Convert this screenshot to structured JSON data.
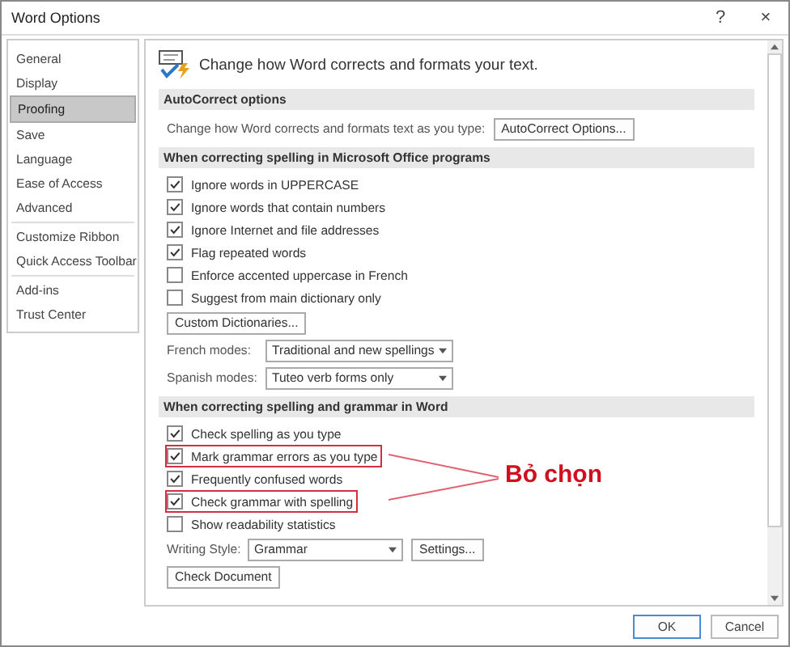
{
  "window": {
    "title": "Word Options",
    "help": "?",
    "close": "×"
  },
  "sidebar": {
    "groups": [
      [
        {
          "label": "General",
          "selected": false
        },
        {
          "label": "Display",
          "selected": false
        },
        {
          "label": "Proofing",
          "selected": true
        },
        {
          "label": "Save",
          "selected": false
        },
        {
          "label": "Language",
          "selected": false
        },
        {
          "label": "Ease of Access",
          "selected": false
        },
        {
          "label": "Advanced",
          "selected": false
        }
      ],
      [
        {
          "label": "Customize Ribbon",
          "selected": false
        },
        {
          "label": "Quick Access Toolbar",
          "selected": false
        }
      ],
      [
        {
          "label": "Add-ins",
          "selected": false
        },
        {
          "label": "Trust Center",
          "selected": false
        }
      ]
    ]
  },
  "heading": "Change how Word corrects and formats your text.",
  "sections": [
    {
      "title": "AutoCorrect options",
      "items": [
        {
          "kind": "text_button",
          "text": "Change how Word corrects and formats text as you type:",
          "button": "AutoCorrect Options..."
        }
      ]
    },
    {
      "title": "When correcting spelling in Microsoft Office programs",
      "items": [
        {
          "kind": "checkbox",
          "label": "Ignore words in UPPERCASE",
          "checked": true,
          "highlighted": false
        },
        {
          "kind": "checkbox",
          "label": "Ignore words that contain numbers",
          "checked": true,
          "highlighted": false
        },
        {
          "kind": "checkbox",
          "label": "Ignore Internet and file addresses",
          "checked": true,
          "highlighted": false
        },
        {
          "kind": "checkbox",
          "label": "Flag repeated words",
          "checked": true,
          "highlighted": false
        },
        {
          "kind": "checkbox",
          "label": "Enforce accented uppercase in French",
          "checked": false,
          "highlighted": false
        },
        {
          "kind": "checkbox",
          "label": "Suggest from main dictionary only",
          "checked": false,
          "highlighted": false
        },
        {
          "kind": "button",
          "label": "Custom Dictionaries..."
        },
        {
          "kind": "dropdown",
          "label": "French modes:",
          "value": "Traditional and new spellings"
        },
        {
          "kind": "dropdown",
          "label": "Spanish modes:",
          "value": "Tuteo verb forms only"
        }
      ]
    },
    {
      "title": "When correcting spelling and grammar in Word",
      "items": [
        {
          "kind": "checkbox",
          "label": "Check spelling as you type",
          "checked": true,
          "highlighted": false
        },
        {
          "kind": "checkbox",
          "label": "Mark grammar errors as you type",
          "checked": true,
          "highlighted": true
        },
        {
          "kind": "checkbox",
          "label": "Frequently confused words",
          "checked": true,
          "highlighted": false
        },
        {
          "kind": "checkbox",
          "label": "Check grammar with spelling",
          "checked": true,
          "highlighted": true
        },
        {
          "kind": "checkbox",
          "label": "Show readability statistics",
          "checked": false,
          "highlighted": false
        },
        {
          "kind": "dropdown_button",
          "label": "Writing Style:",
          "value": "Grammar",
          "button": "Settings..."
        },
        {
          "kind": "button",
          "label": "Check Document"
        }
      ]
    }
  ],
  "annotation": {
    "text": "Bỏ chọn"
  },
  "buttons": [
    {
      "label": "OK",
      "selected": true
    },
    {
      "label": "Cancel",
      "selected": false
    }
  ]
}
